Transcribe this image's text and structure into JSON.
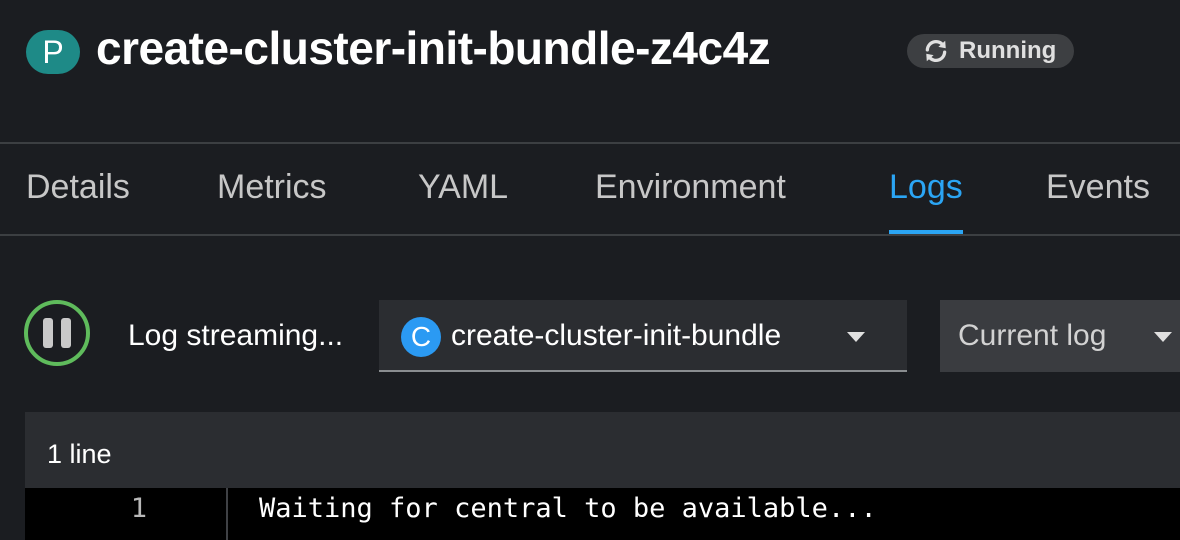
{
  "header": {
    "resource_badge": "P",
    "title": "create-cluster-init-bundle-z4c4z",
    "status": {
      "label": "Running",
      "icon": "sync-icon"
    }
  },
  "tabs": [
    {
      "label": "Details",
      "active": false
    },
    {
      "label": "Metrics",
      "active": false
    },
    {
      "label": "YAML",
      "active": false
    },
    {
      "label": "Environment",
      "active": false
    },
    {
      "label": "Logs",
      "active": true
    },
    {
      "label": "Events",
      "active": false
    }
  ],
  "toolbar": {
    "pause_icon": "pause-icon",
    "stream_status": "Log streaming...",
    "container_select": {
      "badge": "C",
      "value": "create-cluster-init-bundle"
    },
    "log_type_select": {
      "value": "Current log"
    }
  },
  "log": {
    "line_count": "1 line",
    "lines": [
      {
        "number": "1",
        "text": "Waiting for central to be available..."
      }
    ]
  },
  "colors": {
    "background": "#1b1d21",
    "accent": "#2ba5f4",
    "resource_badge": "#1e8a87",
    "container_badge": "#2b9af3",
    "stream_ring": "#5fbb5c"
  }
}
